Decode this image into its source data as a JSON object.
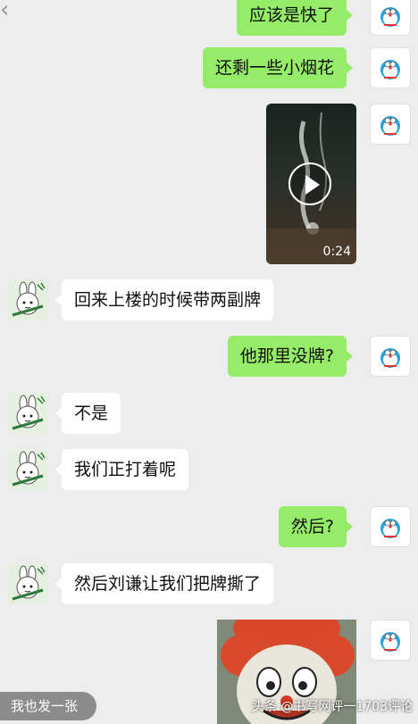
{
  "chat": {
    "messages": [
      {
        "sender": "me",
        "text": "应该是快了"
      },
      {
        "sender": "me",
        "text": "还剩一些小烟花"
      },
      {
        "sender": "me",
        "type": "video",
        "duration": "0:24"
      },
      {
        "sender": "friend",
        "text": "回来上楼的时候带两副牌"
      },
      {
        "sender": "me",
        "text": "他那里没牌?"
      },
      {
        "sender": "friend",
        "text": "不是"
      },
      {
        "sender": "friend",
        "text": "我们正打着呢"
      },
      {
        "sender": "me",
        "text": "然后?"
      },
      {
        "sender": "friend",
        "text": "然后刘谦让我们把牌撕了"
      },
      {
        "sender": "me",
        "type": "image"
      }
    ]
  },
  "overlay": {
    "caption": "我也发一张",
    "watermark": "头条 @书写网评一1703评论"
  },
  "avatars": {
    "me": "doraemon-avatar",
    "friend": "rabbit-sticker-avatar"
  },
  "colors": {
    "background": "#ededed",
    "my_bubble": "#95ec69",
    "friend_bubble": "#ffffff"
  }
}
